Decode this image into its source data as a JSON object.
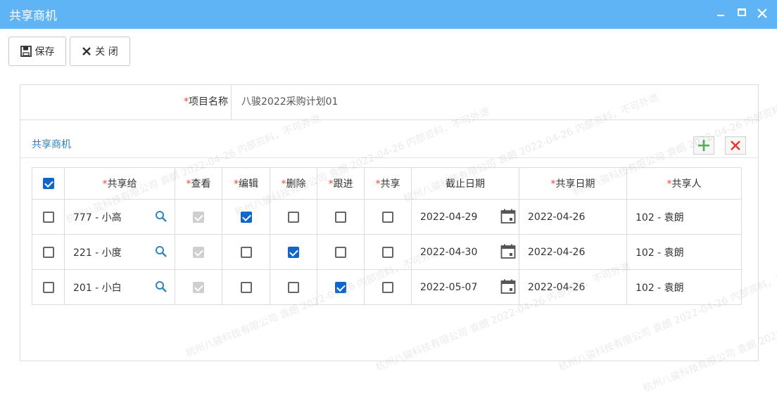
{
  "window": {
    "title": "共享商机"
  },
  "toolbar": {
    "save_label": "保存",
    "close_label": "关 闭"
  },
  "project": {
    "label": "项目名称",
    "value": "八骏2022采购计划01"
  },
  "section": {
    "title": "共享商机"
  },
  "table": {
    "headers": {
      "share_to": "共享给",
      "view": "查看",
      "edit": "编辑",
      "delete": "删除",
      "follow": "跟进",
      "share": "共享",
      "deadline": "截止日期",
      "share_date": "共享日期",
      "sharer": "共享人"
    },
    "header_checked": true,
    "rows": [
      {
        "selected": false,
        "share_to": "777 - 小高",
        "view": true,
        "edit": true,
        "delete": false,
        "follow": false,
        "share": false,
        "deadline": "2022-04-29",
        "share_date": "2022-04-26",
        "sharer": "102 - 袁朗"
      },
      {
        "selected": false,
        "share_to": "221 - 小度",
        "view": true,
        "edit": false,
        "delete": true,
        "follow": false,
        "share": false,
        "deadline": "2022-04-30",
        "share_date": "2022-04-26",
        "sharer": "102 - 袁朗"
      },
      {
        "selected": false,
        "share_to": "201 - 小白",
        "view": true,
        "edit": false,
        "delete": false,
        "follow": true,
        "share": false,
        "deadline": "2022-05-07",
        "share_date": "2022-04-26",
        "sharer": "102 - 袁朗"
      }
    ]
  },
  "watermark": {
    "text": "杭州八骏科技有限公司 袁朗 2022-04-26 内部资料，不可外泄"
  },
  "colors": {
    "titlebar": "#5eb4f5",
    "accent": "#1166cc",
    "required": "#e74c3c",
    "add": "#4caf50",
    "delete": "#e53935"
  }
}
